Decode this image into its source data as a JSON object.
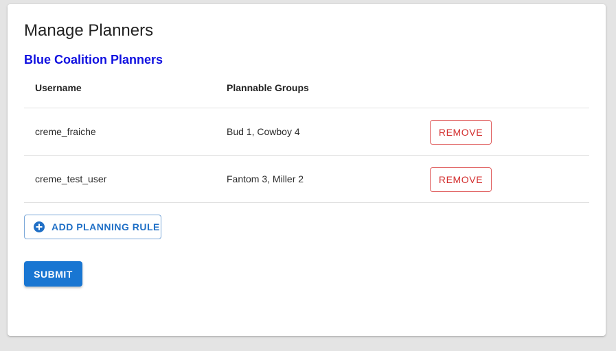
{
  "page": {
    "title": "Manage Planners"
  },
  "section": {
    "title": "Blue Coalition Planners"
  },
  "table": {
    "headers": {
      "username": "Username",
      "groups": "Plannable Groups"
    },
    "rows": [
      {
        "username": "creme_fraiche",
        "groups": "Bud 1, Cowboy 4",
        "action_label": "REMOVE"
      },
      {
        "username": "creme_test_user",
        "groups": "Fantom 3, Miller 2",
        "action_label": "REMOVE"
      }
    ]
  },
  "actions": {
    "add_rule_label": "ADD PLANNING RULE",
    "add_rule_icon": "plus-circle-icon",
    "submit_label": "SUBMIT"
  },
  "colors": {
    "page_background": "#e4e4e4",
    "section_title": "#1010e0",
    "primary": "#1976d2",
    "danger": "#d32f2f"
  }
}
